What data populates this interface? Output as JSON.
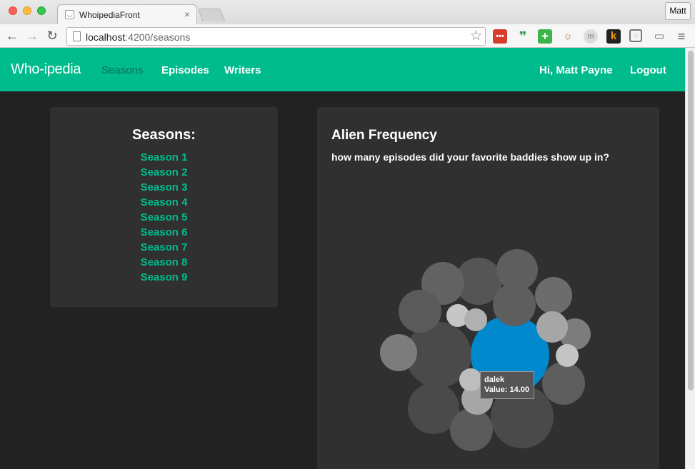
{
  "browser": {
    "tab_title": "WhoipediaFront",
    "url_host": "localhost",
    "url_path": ":4200/seasons",
    "profile_name": "Matt"
  },
  "navbar": {
    "brand": "Who-ipedia",
    "links": [
      "Seasons",
      "Episodes",
      "Writers"
    ],
    "active_link": "Seasons",
    "greeting": "Hi, Matt Payne",
    "logout": "Logout",
    "color": "#00bc8c"
  },
  "seasons_panel": {
    "title": "Seasons:",
    "items": [
      "Season 1",
      "Season 2",
      "Season 3",
      "Season 4",
      "Season 5",
      "Season 6",
      "Season 7",
      "Season 8",
      "Season 9"
    ]
  },
  "chart_panel": {
    "title": "Alien Frequency",
    "subtitle": "how many episodes did your favorite baddies show up in?",
    "tooltip": {
      "name": "dalek",
      "value_text": "Value: 14.00"
    }
  },
  "chart_data": {
    "type": "bubble",
    "highlight_color": "#0088cc",
    "series": [
      {
        "name": "dalek",
        "value": 14.0,
        "highlighted": true
      }
    ]
  }
}
